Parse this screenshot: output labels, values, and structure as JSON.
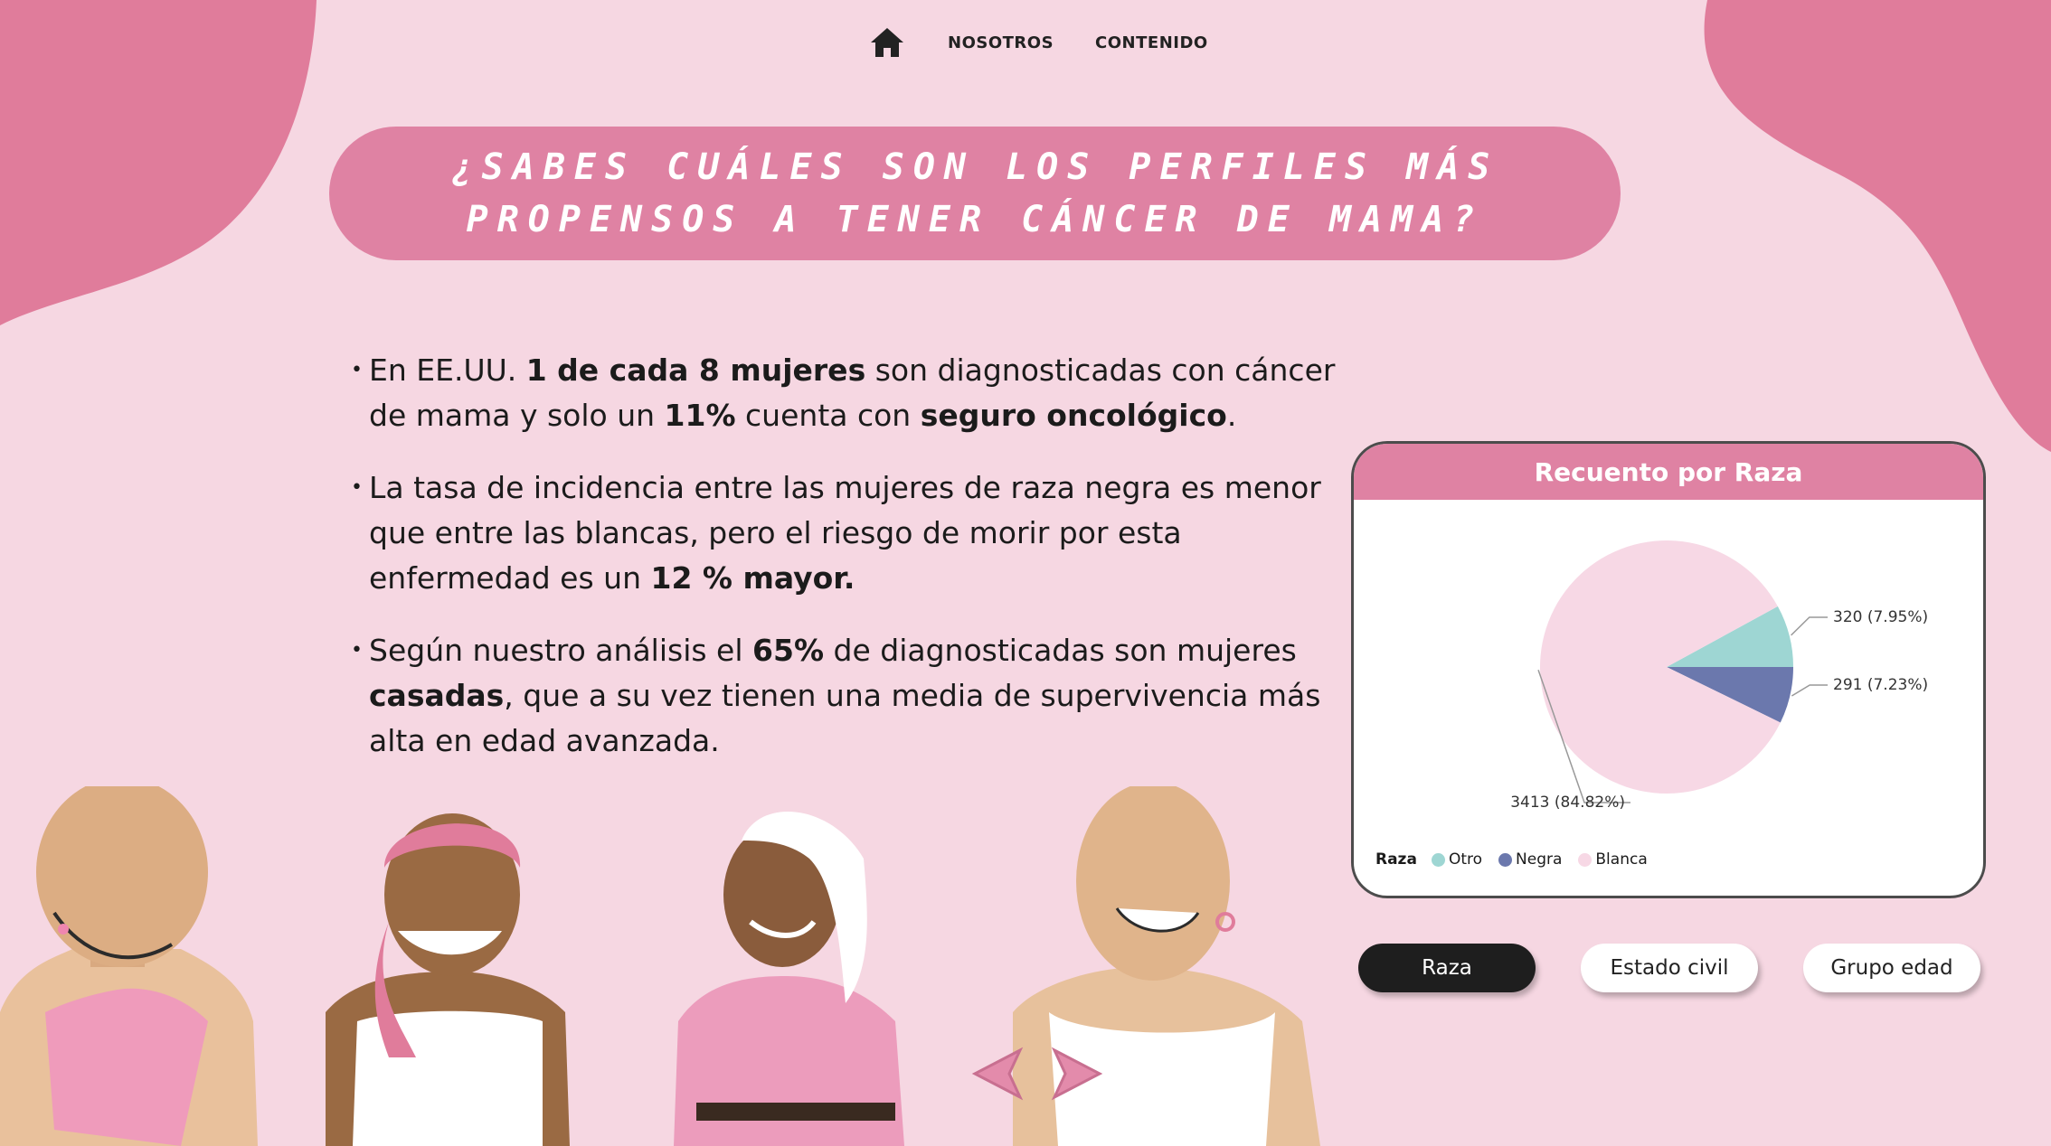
{
  "nav": {
    "home_icon": "home-icon",
    "links": [
      "NOSOTROS",
      "CONTENIDO"
    ]
  },
  "banner": {
    "title": "¿SABES CUÁLES SON LOS PERFILES MÁS PROPENSOS A TENER CÁNCER DE MAMA?"
  },
  "bullets": [
    [
      "En EE.UU. ",
      "1 de cada 8 mujeres",
      " son diagnosticadas con cáncer de mama y solo un ",
      "11%",
      " cuenta con ",
      "seguro oncológico",
      "."
    ],
    [
      "La tasa de incidencia entre las mujeres de raza negra es menor que entre las blancas, pero el riesgo de morir por esta enfermedad es un ",
      "12 % mayor."
    ],
    [
      "Según nuestro análisis el ",
      "65%",
      " de diagnosticadas son mujeres ",
      "casadas",
      ", que a su vez tienen una media de supervivencia más alta en edad avanzada."
    ]
  ],
  "chart_card": {
    "title": "Recuento por Raza",
    "legend_title": "Raza"
  },
  "chart_data": {
    "type": "pie",
    "title": "Recuento por Raza",
    "slices": [
      {
        "label": "Otro",
        "value": 320,
        "percent": 7.95,
        "display": "320 (7.95%)",
        "color": "#9ed6d3"
      },
      {
        "label": "Negra",
        "value": 291,
        "percent": 7.23,
        "display": "291 (7.23%)",
        "color": "#6b78ad"
      },
      {
        "label": "Blanca",
        "value": 3413,
        "percent": 84.82,
        "display": "3413 (84.82%)",
        "color": "#f7d8e5"
      }
    ],
    "legend_title": "Raza",
    "legend_placement": "bottom-left"
  },
  "filters": {
    "buttons": [
      "Raza",
      "Estado civil",
      "Grupo edad"
    ],
    "selected": "Raza"
  },
  "colors": {
    "background": "#f6d7e2",
    "accent": "#df82a3",
    "blob": "#e07c9b",
    "active_button": "#1e1e1e"
  }
}
